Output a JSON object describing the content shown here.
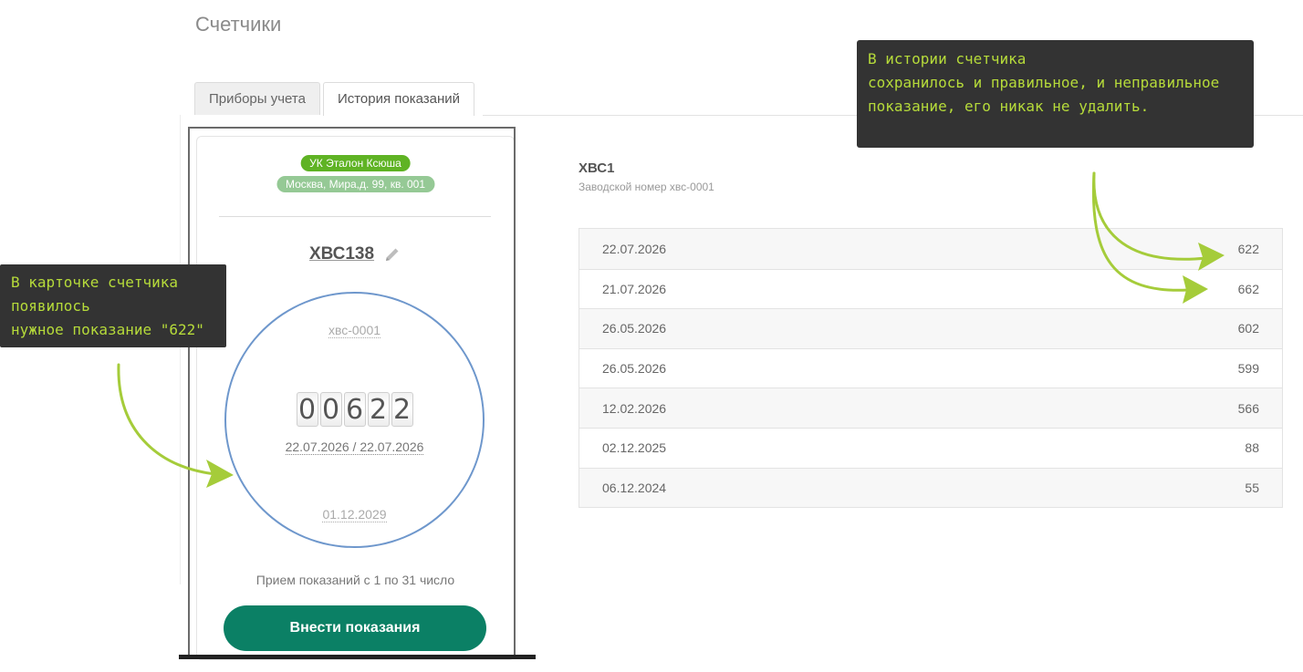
{
  "page": {
    "title": "Счетчики"
  },
  "tabs": [
    {
      "label": "Приборы учета",
      "active": false
    },
    {
      "label": "История показаний",
      "active": true
    }
  ],
  "card": {
    "company_badge": "УК Эталон Ксюша",
    "address_badge": "Москва, Мира,д. 99, кв. 001",
    "meter_name": "ХВС138",
    "edit_icon": "pencil-icon",
    "serial": "хвс-0001",
    "reading_digits": [
      "0",
      "0",
      "6",
      "2",
      "2"
    ],
    "reading_dates": "22.07.2026 / 22.07.2026",
    "verification_date": "01.12.2029",
    "accept_text": "Прием показаний с 1 по 31 число",
    "submit_label": "Внести показания"
  },
  "history": {
    "meter_title": "ХВС1",
    "factory_number": "Заводской номер хвс-0001",
    "rows": [
      {
        "date": "22.07.2026",
        "value": "622"
      },
      {
        "date": "21.07.2026",
        "value": "662"
      },
      {
        "date": "26.05.2026",
        "value": "602"
      },
      {
        "date": "26.05.2026",
        "value": "599"
      },
      {
        "date": "12.02.2026",
        "value": "566"
      },
      {
        "date": "02.12.2025",
        "value": "88"
      },
      {
        "date": "06.12.2024",
        "value": "55"
      }
    ]
  },
  "annotations": {
    "left_note": "В карточке счетчика\nпоявилось\nнужное показание \"622\"",
    "right_note": "В истории счетчика\nсохранилось и правильное, и неправильное\nпоказание, его никак не удалить.",
    "accent_color": "#a5cc3a"
  },
  "colors": {
    "company_badge": "#5fb324",
    "address_badge": "#95c995",
    "submit_button": "#0b8065",
    "dial_border": "#6e97cc",
    "note_background": "#333333",
    "note_text": "#b6db3a"
  }
}
